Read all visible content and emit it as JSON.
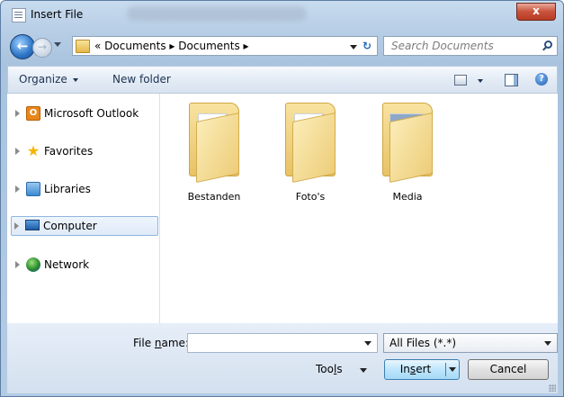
{
  "window": {
    "title": "Insert File",
    "close_label": "x"
  },
  "navigation": {
    "back_symbol": "←",
    "forward_symbol": "→",
    "address": {
      "prefix": "«",
      "path": [
        "Documents",
        "Documents"
      ],
      "separator": "▸"
    },
    "search": {
      "placeholder": "Search Documents"
    },
    "refresh_symbol": "↻"
  },
  "toolbar": {
    "organize_label": "Organize",
    "new_folder_label": "New folder",
    "help_symbol": "?"
  },
  "sidebar": {
    "items": [
      {
        "label": "Microsoft Outlook",
        "icon": "outlook-icon",
        "icon_glyph": "O"
      },
      {
        "label": "Favorites",
        "icon": "star-icon",
        "icon_glyph": "★"
      },
      {
        "label": "Libraries",
        "icon": "libraries-icon"
      },
      {
        "label": "Computer",
        "icon": "computer-icon",
        "selected": true
      },
      {
        "label": "Network",
        "icon": "network-icon"
      }
    ]
  },
  "folders": [
    {
      "name": "Bestanden"
    },
    {
      "name": "Foto's"
    },
    {
      "name": "Media"
    }
  ],
  "footer": {
    "file_name_label_pre": "File ",
    "file_name_label_u": "n",
    "file_name_label_post": "ame:",
    "file_name_value": "",
    "filter_value": "All Files (*.*)",
    "tools_pre": "Too",
    "tools_u": "l",
    "tools_post": "s",
    "insert_pre": "In",
    "insert_u": "s",
    "insert_post": "ert",
    "cancel_label": "Cancel"
  },
  "colors": {
    "accent": "#3c7fb1",
    "selection_border": "#8fb6e0",
    "frame": "#b9cfe7"
  }
}
